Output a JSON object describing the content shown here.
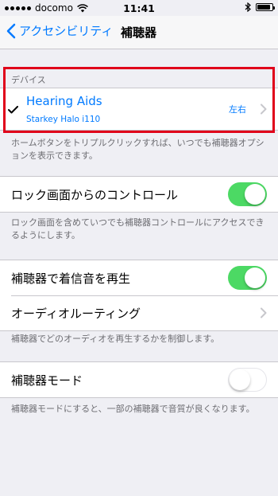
{
  "status_bar": {
    "carrier": "docomo",
    "time": "11:41",
    "battery_level": 0.9
  },
  "nav": {
    "back_label": "アクセシビリティ",
    "title": "補聴器"
  },
  "devices_section": {
    "header": "デバイス",
    "device": {
      "name": "Hearing Aids",
      "model": "Starkey Halo i110",
      "side": "左右",
      "selected": true
    },
    "footer": "ホームボタンをトリプルクリックすれば、いつでも補聴器オプションを表示できます。"
  },
  "lock_screen_section": {
    "label": "ロック画面からのコントロール",
    "enabled": true,
    "footer": "ロック画面を含めていつでも補聴器コントロールにアクセスできるようにします。"
  },
  "audio_section": {
    "ringtone_label": "補聴器で着信音を再生",
    "ringtone_enabled": true,
    "routing_label": "オーディオルーティング",
    "footer": "補聴器でどのオーディオを再生するかを制御します。"
  },
  "mode_section": {
    "label": "補聴器モード",
    "enabled": false,
    "footer": "補聴器モードにすると、一部の補聴器で音質が良くなります。"
  },
  "colors": {
    "accent": "#007aff",
    "toggle_on": "#4cd964",
    "highlight": "#e0001a",
    "background": "#efeff4"
  }
}
